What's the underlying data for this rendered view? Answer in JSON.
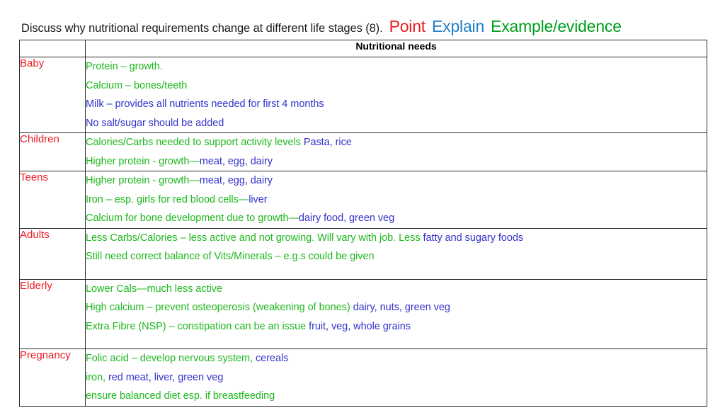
{
  "title": {
    "question": "Discuss why nutritional requirements change at different life stages (8).",
    "legend": [
      {
        "label": "Point",
        "color": "#ec1c24",
        "name": "point"
      },
      {
        "label": "Explain",
        "color": "#1f7fc4",
        "name": "explain"
      },
      {
        "label": "Example/evidence",
        "color": "#00a01e",
        "name": "example"
      }
    ]
  },
  "table": {
    "columns": [
      "",
      "Nutritional needs"
    ],
    "header": {
      "stage": "",
      "needs": "Nutritional needs"
    },
    "rows": [
      {
        "stage": "Baby",
        "pad": false,
        "lines": [
          [
            {
              "text": "Protein – growth.",
              "color": "green"
            }
          ],
          [
            {
              "text": "Calcium – bones/teeth",
              "color": "green"
            }
          ],
          [
            {
              "text": "Milk – provides all nutrients needed for first 4 months",
              "color": "blue"
            }
          ],
          [
            {
              "text": "No salt/sugar should be added",
              "color": "blue"
            }
          ]
        ]
      },
      {
        "stage": "Children",
        "pad": false,
        "lines": [
          [
            {
              "text": "Calories/Carbs needed to support activity levels ",
              "color": "green"
            },
            {
              "text": "Pasta, rice",
              "color": "blue"
            }
          ],
          [
            {
              "text": "Higher protein - growth—",
              "color": "green"
            },
            {
              "text": "meat, egg, dairy",
              "color": "blue"
            }
          ]
        ]
      },
      {
        "stage": "Teens",
        "pad": false,
        "lines": [
          [
            {
              "text": "Higher protein - growth—",
              "color": "green"
            },
            {
              "text": "meat, egg, dairy",
              "color": "blue"
            }
          ],
          [
            {
              "text": "Iron – esp. girls  for red blood cells—",
              "color": "green"
            },
            {
              "text": "liver",
              "color": "blue"
            }
          ],
          [
            {
              "text": "Calcium for bone development due to growth—",
              "color": "green"
            },
            {
              "text": "dairy food, green veg",
              "color": "blue"
            }
          ]
        ]
      },
      {
        "stage": "Adults",
        "pad": true,
        "lines": [
          [
            {
              "text": "Less Carbs/Calories – less active and not growing. Will vary with job. Less ",
              "color": "green"
            },
            {
              "text": "fatty and sugary foods",
              "color": "blue"
            }
          ],
          [
            {
              "text": "Still need correct balance of Vits/Minerals – e.g.s could be given",
              "color": "green"
            }
          ]
        ]
      },
      {
        "stage": "Elderly",
        "pad": true,
        "lines": [
          [
            {
              "text": "Lower Cals—much less active",
              "color": "green"
            }
          ],
          [
            {
              "text": "High calcium – prevent osteoperosis (weakening of bones) ",
              "color": "green"
            },
            {
              "text": "dairy, nuts, green veg",
              "color": "blue"
            }
          ],
          [
            {
              "text": "Extra Fibre (NSP) – constipation can be an issue ",
              "color": "green"
            },
            {
              "text": "fruit, veg, whole grains",
              "color": "blue"
            }
          ]
        ]
      },
      {
        "stage": "Pregnancy",
        "pad": false,
        "lines": [
          [
            {
              "text": "Folic acid – develop nervous system, ",
              "color": "green"
            },
            {
              "text": "cereals",
              "color": "blue"
            }
          ],
          [
            {
              "text": "iron, ",
              "color": "green"
            },
            {
              "text": "red meat, liver, green veg",
              "color": "blue"
            }
          ],
          [
            {
              "text": "ensure balanced diet esp. if breastfeeding",
              "color": "green"
            }
          ]
        ]
      }
    ]
  },
  "colors": {
    "point_red": "#ec1c24",
    "explain_blue": "#1f7fc4",
    "example_green": "#00a01e",
    "body_green": "#1eb81e",
    "body_blue": "#3333cc",
    "stage_red": "#ec1c24",
    "border": "#2b2b2b",
    "background": "#ffffff"
  }
}
